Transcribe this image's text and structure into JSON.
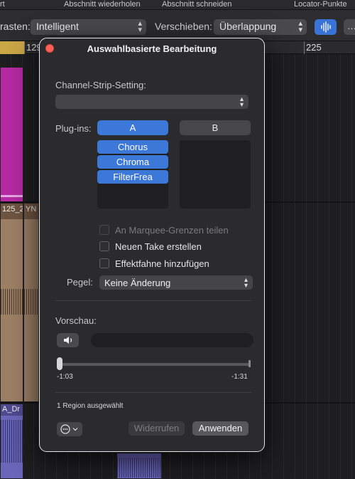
{
  "top_menu": {
    "item0": "rt",
    "item1": "Abschnitt wiederholen",
    "item2": "Abschnitt schneiden",
    "item3": "Locator-Punkte"
  },
  "control_bar": {
    "snap_label": "rasten:",
    "snap_value": "Intelligent",
    "move_label": "Verschieben:",
    "move_value": "Überlappung",
    "more_icon": "…"
  },
  "ruler": {
    "left_bar": "129",
    "right_bar": "225"
  },
  "regions": {
    "region1": "125_2",
    "region2": "YN",
    "region3": "A_Dr"
  },
  "dialog": {
    "title": "Auswahlbasierte Bearbeitung",
    "channel_strip_label": "Channel-Strip-Setting:",
    "channel_strip_value": "",
    "plugins_label": "Plug-ins:",
    "tab_a": "A",
    "tab_b": "B",
    "plugins_a": [
      "Chorus",
      "Chroma",
      "FilterFrea"
    ],
    "checkbox_split": "An Marquee-Grenzen teilen",
    "checkbox_take": "Neuen Take erstellen",
    "checkbox_effect": "Effektfahne hinzufügen",
    "level_label": "Pegel:",
    "level_value": "Keine Änderung",
    "preview_label": "Vorschau:",
    "time_start": "-1:03",
    "time_end": "-1:31",
    "status": "1 Region ausgewählt",
    "undo_button": "Widerrufen",
    "apply_button": "Anwenden"
  },
  "colors": {
    "accent": "#3c78d8",
    "close_button": "#ff5f57",
    "region_magenta": "#b52aa2",
    "region_tan": "#9c8066",
    "region_purple": "#6a66b8",
    "cycle": "#c9a646"
  },
  "icons": {
    "speaker": "speaker-icon",
    "more": "ellipsis-circle-icon",
    "chevron": "chevron-updown-icon",
    "waveform": "waveform-icon"
  }
}
